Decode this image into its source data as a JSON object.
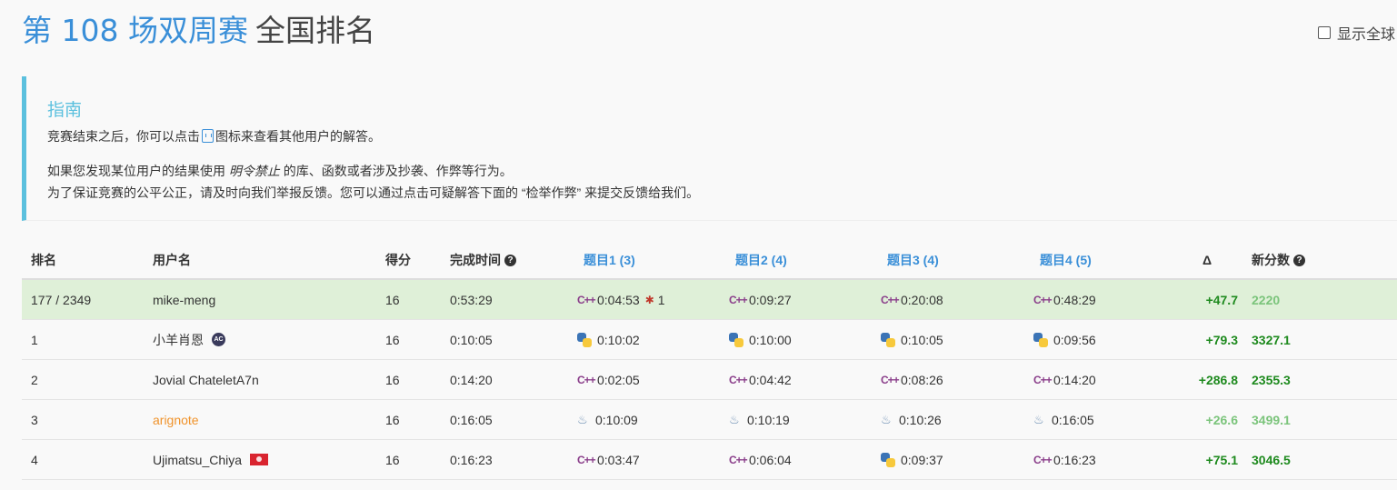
{
  "header": {
    "contest": "第 108 场双周赛",
    "suffix": "全国排名",
    "global_toggle_label": "显示全球"
  },
  "guide": {
    "title": "指南",
    "line1_before": "竞赛结束之后，你可以点击",
    "line1_icon": "code-doc-icon",
    "line1_after": "图标来查看其他用户的解答。",
    "line2_before": "如果您发现某位用户的结果使用",
    "line2_em": "明令禁止",
    "line2_after": "的库、函数或者涉及抄袭、作弊等行为。",
    "line3": "为了保证竞赛的公平公正，请及时向我们举报反馈。您可以通过点击可疑解答下面的 “检举作弊” 来提交反馈给我们。"
  },
  "table": {
    "headers": {
      "rank": "排名",
      "user": "用户名",
      "score": "得分",
      "time": "完成时间",
      "q1": "题目1 (3)",
      "q2": "题目2 (4)",
      "q3": "题目3 (4)",
      "q4": "题目4 (5)",
      "delta": "Δ",
      "rating": "新分数"
    },
    "me": {
      "rank": "177 / 2349",
      "user": "mike-meng",
      "score": "16",
      "time": "0:53:29",
      "q1": {
        "lang": "cpp",
        "time": "0:04:53",
        "bugs": "1"
      },
      "q2": {
        "lang": "cpp",
        "time": "0:09:27"
      },
      "q3": {
        "lang": "cpp",
        "time": "0:20:08"
      },
      "q4": {
        "lang": "cpp",
        "time": "0:48:29"
      },
      "delta": "+47.7",
      "rating": "2220"
    },
    "rows": [
      {
        "rank": "1",
        "user": "小羊肖恩",
        "badge": "AC",
        "score": "16",
        "time": "0:10:05",
        "q1": {
          "lang": "python",
          "time": "0:10:02"
        },
        "q2": {
          "lang": "python",
          "time": "0:10:00"
        },
        "q3": {
          "lang": "python",
          "time": "0:10:05"
        },
        "q4": {
          "lang": "python",
          "time": "0:09:56"
        },
        "delta": "+79.3",
        "rating": "3327.1"
      },
      {
        "rank": "2",
        "user": "Jovial ChateletA7n",
        "score": "16",
        "time": "0:14:20",
        "q1": {
          "lang": "cpp",
          "time": "0:02:05"
        },
        "q2": {
          "lang": "cpp",
          "time": "0:04:42"
        },
        "q3": {
          "lang": "cpp",
          "time": "0:08:26"
        },
        "q4": {
          "lang": "cpp",
          "time": "0:14:20"
        },
        "delta": "+286.8",
        "rating": "2355.3"
      },
      {
        "rank": "3",
        "user": "arignote",
        "score": "16",
        "time": "0:16:05",
        "q1": {
          "lang": "java",
          "time": "0:10:09"
        },
        "q2": {
          "lang": "java",
          "time": "0:10:19"
        },
        "q3": {
          "lang": "java",
          "time": "0:10:26"
        },
        "q4": {
          "lang": "java",
          "time": "0:16:05"
        },
        "delta": "+26.6",
        "rating": "3499.1"
      },
      {
        "rank": "4",
        "user": "Ujimatsu_Chiya",
        "score": "16",
        "time": "0:16:23",
        "q1": {
          "lang": "cpp",
          "time": "0:03:47"
        },
        "q2": {
          "lang": "cpp",
          "time": "0:06:04"
        },
        "q3": {
          "lang": "python",
          "time": "0:09:37"
        },
        "q4": {
          "lang": "cpp",
          "time": "0:16:23"
        },
        "delta": "+75.1",
        "rating": "3046.5"
      }
    ]
  },
  "colors": {
    "accent": "#3a8fd8",
    "info": "#5bc0de",
    "highlight_row": "#dff0d8",
    "rating_green": "#1e8a1e",
    "rating_light_green": "#7bc47b",
    "username_orange": "#f0932b",
    "cpp_purple": "#8a3e8a"
  }
}
